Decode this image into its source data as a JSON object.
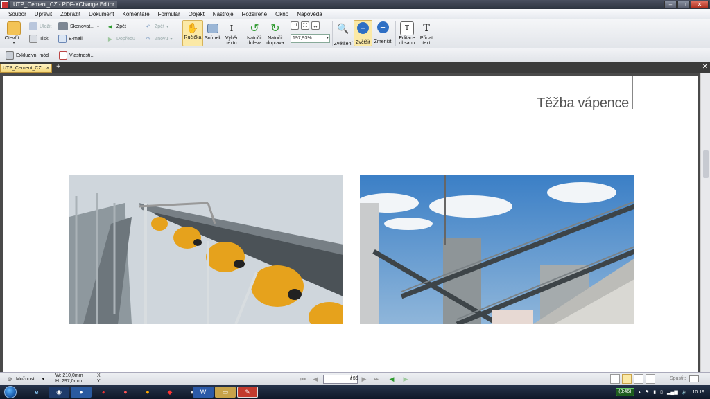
{
  "window": {
    "title": "UTP_Cement_CZ - PDF-XChange Editor"
  },
  "menu": [
    "Soubor",
    "Upravit",
    "Zobrazit",
    "Dokument",
    "Komentáře",
    "Formulář",
    "Objekt",
    "Nástroje",
    "Rozšířené",
    "Okno",
    "Nápověda"
  ],
  "toolbar": {
    "open": "Otevřít...",
    "save": "Uložit",
    "print": "Tisk",
    "scan": "Skenovat...",
    "email": "E-mail",
    "back": "Zpět",
    "forward": "Dopředu",
    "undo": "Zpět",
    "redo": "Znovu",
    "hand": "Ručička",
    "snapshot": "Snímek",
    "select_text_1": "Výběr",
    "select_text_2": "textu",
    "rotate_left_1": "Natočit",
    "rotate_left_2": "doleva",
    "rotate_right_1": "Natočit",
    "rotate_right_2": "doprava",
    "zoom_value": "197,93%",
    "loupe": "Zvětšení",
    "zoom_in": "Zvětšit",
    "zoom_out": "Zmenšit",
    "edit_content_1": "Editace",
    "edit_content_2": "obsahu",
    "add_text_1": "Přidat",
    "add_text_2": "text"
  },
  "toolbar2": {
    "exclusive": "Exkluzivní mód",
    "properties": "Vlastnosti..."
  },
  "tab": {
    "name": "UTP_Cement_CZ"
  },
  "document": {
    "heading": "Těžba vápence"
  },
  "status": {
    "options": "Možnosti...",
    "width": "W: 210,0mm",
    "height": "H: 297,0mm",
    "x": "X:",
    "y": "Y:",
    "page_current": "11",
    "page_total": "/ 36",
    "run": "Spustit:"
  },
  "taskbar": {
    "battery": "(3:46)",
    "clock": "10:19"
  },
  "colors": {
    "active_tool": "#fbe9a6",
    "tab_active": "#f4d77a",
    "heading": "#555555"
  }
}
